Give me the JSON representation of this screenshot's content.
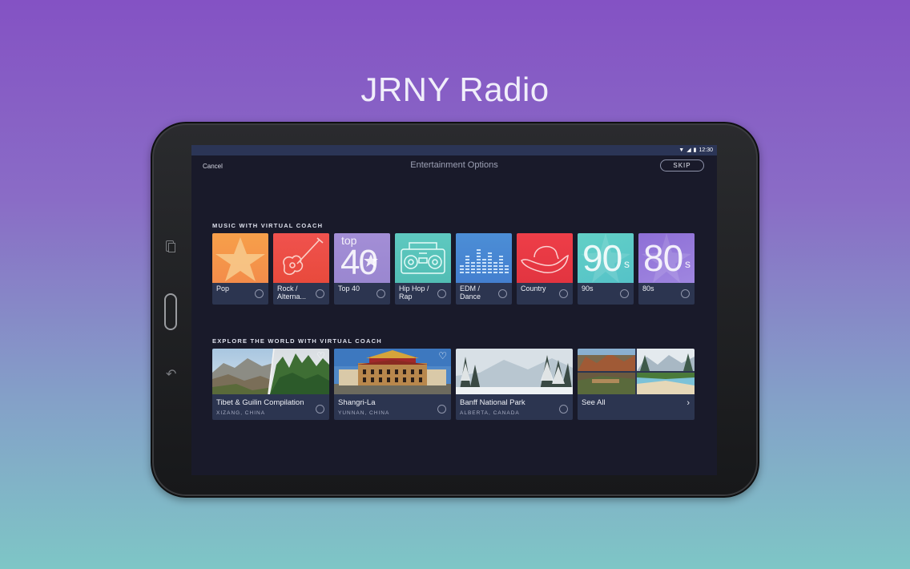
{
  "promo_title": "JRNY Radio",
  "status_bar": {
    "time": "12:30"
  },
  "app_bar": {
    "cancel_label": "Cancel",
    "title": "Entertainment Options",
    "skip_label": "SKIP"
  },
  "music_section": {
    "label": "MUSIC WITH VIRTUAL COACH",
    "items": [
      {
        "name": "Pop"
      },
      {
        "name": "Rock / Alterna..."
      },
      {
        "name": "Top 40",
        "art_text": "top",
        "art_number": "40"
      },
      {
        "name": "Hip Hop / Rap"
      },
      {
        "name": "EDM / Dance"
      },
      {
        "name": "Country"
      },
      {
        "name": "90s",
        "art_number": "90",
        "art_suffix": "s"
      },
      {
        "name": "80s",
        "art_number": "80",
        "art_suffix": "s"
      }
    ]
  },
  "world_section": {
    "label": "EXPLORE THE WORLD WITH VIRTUAL COACH",
    "items": [
      {
        "name": "Tibet & Guilin Compilation",
        "location": "XIZANG, CHINA"
      },
      {
        "name": "Shangri-La",
        "location": "YUNNAN, CHINA"
      },
      {
        "name": "Banff National Park",
        "location": "ALBERTA, CANADA"
      },
      {
        "name": "See All"
      }
    ]
  }
}
